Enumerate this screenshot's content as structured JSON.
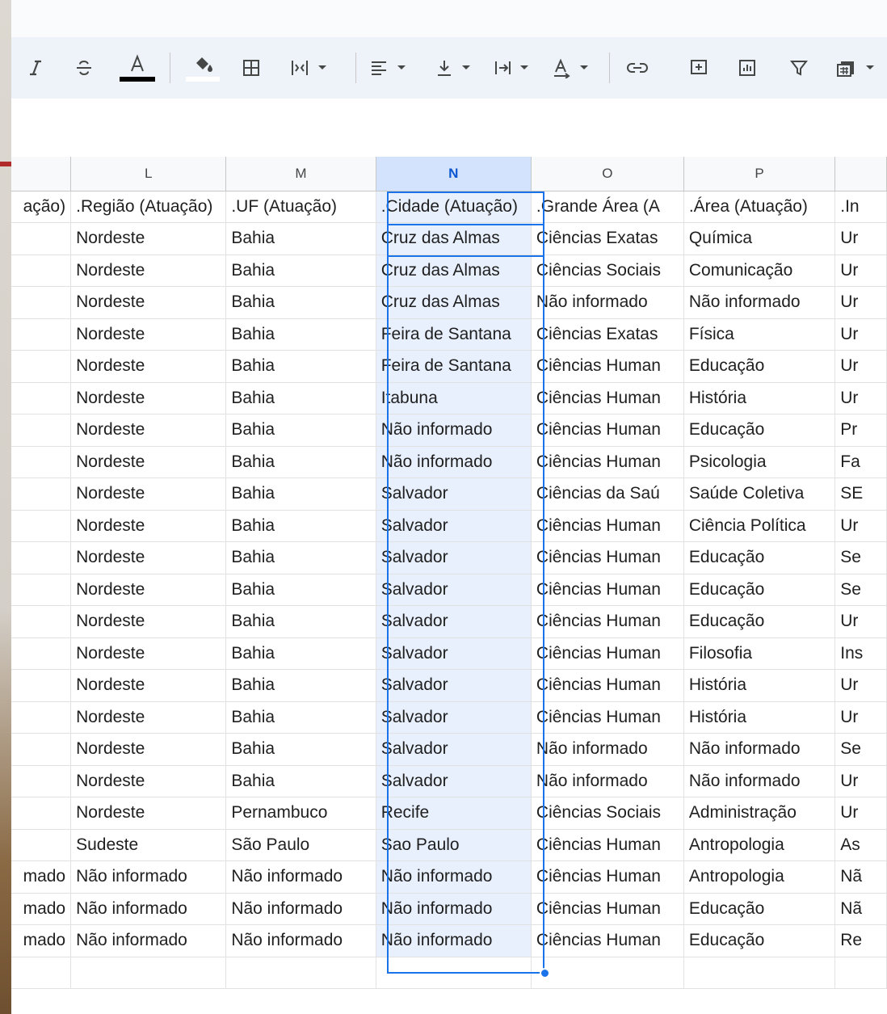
{
  "toolbar": {
    "items": [
      "italic",
      "strikethrough",
      "text-color",
      "fill-color",
      "borders",
      "merge-cells",
      "horizontal-align",
      "vertical-align",
      "text-wrapping",
      "text-rotation",
      "insert-link",
      "insert-comment",
      "insert-chart",
      "create-filter",
      "filter-views"
    ]
  },
  "sheet": {
    "columns": [
      "L",
      "M",
      "N",
      "O",
      "P"
    ],
    "selected_column": "N",
    "header_row": [
      ".Região (Atuação)",
      ".UF (Atuação)",
      ".Cidade (Atuação)",
      ".Grande Área (A",
      ".Área (Atuação)"
    ],
    "left_partial_header": "ação)",
    "right_partial_header": ".In",
    "rows": [
      {
        "left": "",
        "L": "Nordeste",
        "M": "Bahia",
        "N": "Cruz das Almas",
        "O": "Ciências Exatas",
        "P": "Química",
        "Q": "Ur"
      },
      {
        "left": "",
        "L": "Nordeste",
        "M": "Bahia",
        "N": "Cruz das Almas",
        "O": "Ciências Sociais",
        "P": "Comunicação",
        "Q": "Ur"
      },
      {
        "left": "",
        "L": "Nordeste",
        "M": "Bahia",
        "N": "Cruz das Almas",
        "O": "Não informado",
        "P": "Não informado",
        "Q": "Ur"
      },
      {
        "left": "",
        "L": "Nordeste",
        "M": "Bahia",
        "N": "Feira de Santana",
        "O": "Ciências Exatas",
        "P": "Física",
        "Q": "Ur"
      },
      {
        "left": "",
        "L": "Nordeste",
        "M": "Bahia",
        "N": "Feira de Santana",
        "O": "Ciências Human",
        "P": "Educação",
        "Q": "Ur"
      },
      {
        "left": "",
        "L": "Nordeste",
        "M": "Bahia",
        "N": "Itabuna",
        "O": "Ciências Human",
        "P": "História",
        "Q": "Ur"
      },
      {
        "left": "",
        "L": "Nordeste",
        "M": "Bahia",
        "N": "Não informado",
        "O": "Ciências Human",
        "P": "Educação",
        "Q": "Pr"
      },
      {
        "left": "",
        "L": "Nordeste",
        "M": "Bahia",
        "N": "Não informado",
        "O": "Ciências Human",
        "P": "Psicologia",
        "Q": "Fa"
      },
      {
        "left": "",
        "L": "Nordeste",
        "M": "Bahia",
        "N": "Salvador",
        "O": "Ciências da Saú",
        "P": "Saúde Coletiva",
        "Q": "SE"
      },
      {
        "left": "",
        "L": "Nordeste",
        "M": "Bahia",
        "N": "Salvador",
        "O": "Ciências Human",
        "P": "Ciência Política",
        "Q": "Ur"
      },
      {
        "left": "",
        "L": "Nordeste",
        "M": "Bahia",
        "N": "Salvador",
        "O": "Ciências Human",
        "P": "Educação",
        "Q": "Se"
      },
      {
        "left": "",
        "L": "Nordeste",
        "M": "Bahia",
        "N": "Salvador",
        "O": "Ciências Human",
        "P": "Educação",
        "Q": "Se"
      },
      {
        "left": "",
        "L": "Nordeste",
        "M": "Bahia",
        "N": "Salvador",
        "O": "Ciências Human",
        "P": "Educação",
        "Q": "Ur"
      },
      {
        "left": "",
        "L": "Nordeste",
        "M": "Bahia",
        "N": "Salvador",
        "O": "Ciências Human",
        "P": "Filosofia",
        "Q": "Ins"
      },
      {
        "left": "",
        "L": "Nordeste",
        "M": "Bahia",
        "N": "Salvador",
        "O": "Ciências Human",
        "P": "História",
        "Q": "Ur"
      },
      {
        "left": "",
        "L": "Nordeste",
        "M": "Bahia",
        "N": "Salvador",
        "O": "Ciências Human",
        "P": "História",
        "Q": "Ur"
      },
      {
        "left": "",
        "L": "Nordeste",
        "M": "Bahia",
        "N": "Salvador",
        "O": "Não informado",
        "P": "Não informado",
        "Q": "Se"
      },
      {
        "left": "",
        "L": "Nordeste",
        "M": "Bahia",
        "N": "Salvador",
        "O": "Não informado",
        "P": "Não informado",
        "Q": "Ur"
      },
      {
        "left": "",
        "L": "Nordeste",
        "M": "Pernambuco",
        "N": "Recife",
        "O": "Ciências Sociais",
        "P": "Administração",
        "Q": "Ur"
      },
      {
        "left": "",
        "L": "Sudeste",
        "M": "São Paulo",
        "N": "Sao Paulo",
        "O": "Ciências Human",
        "P": "Antropologia",
        "Q": "As"
      },
      {
        "left": "mado",
        "L": "Não informado",
        "M": "Não informado",
        "N": "Não informado",
        "O": "Ciências Human",
        "P": "Antropologia",
        "Q": "Nã"
      },
      {
        "left": "mado",
        "L": "Não informado",
        "M": "Não informado",
        "N": "Não informado",
        "O": "Ciências Human",
        "P": "Educação",
        "Q": "Nã"
      },
      {
        "left": "mado",
        "L": "Não informado",
        "M": "Não informado",
        "N": "Não informado",
        "O": "Ciências Human",
        "P": "Educação",
        "Q": "Re"
      }
    ]
  },
  "colors": {
    "selection": "#1a73e8",
    "selected_column_fill": "#e8f0fe",
    "toolbar_bg": "#eef2f9"
  }
}
